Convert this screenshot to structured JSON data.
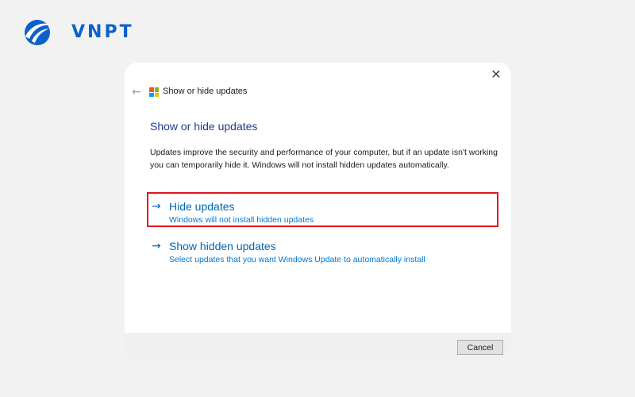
{
  "brand": {
    "text": "VNPT",
    "color": "#0a62c9"
  },
  "dialog": {
    "app_title": "Show or hide updates",
    "heading": "Show or hide updates",
    "description": "Updates improve the security and performance of your computer, but if an update isn't working you can temporarily hide it. Windows will not install hidden updates automatically.",
    "options": [
      {
        "title": "Hide updates",
        "subtitle": "Windows will not install hidden updates",
        "highlighted": true
      },
      {
        "title": "Show hidden updates",
        "subtitle": "Select updates that you want Windows Update to automatically install",
        "highlighted": false
      }
    ],
    "cancel_label": "Cancel",
    "icons": {
      "close": "close-icon",
      "back": "back-arrow-icon",
      "app": "windows-logo-icon",
      "option_arrow": "arrow-right-icon"
    }
  },
  "colors": {
    "link": "#0066b4",
    "heading": "#1f3c88",
    "highlight": "#e0161e"
  }
}
